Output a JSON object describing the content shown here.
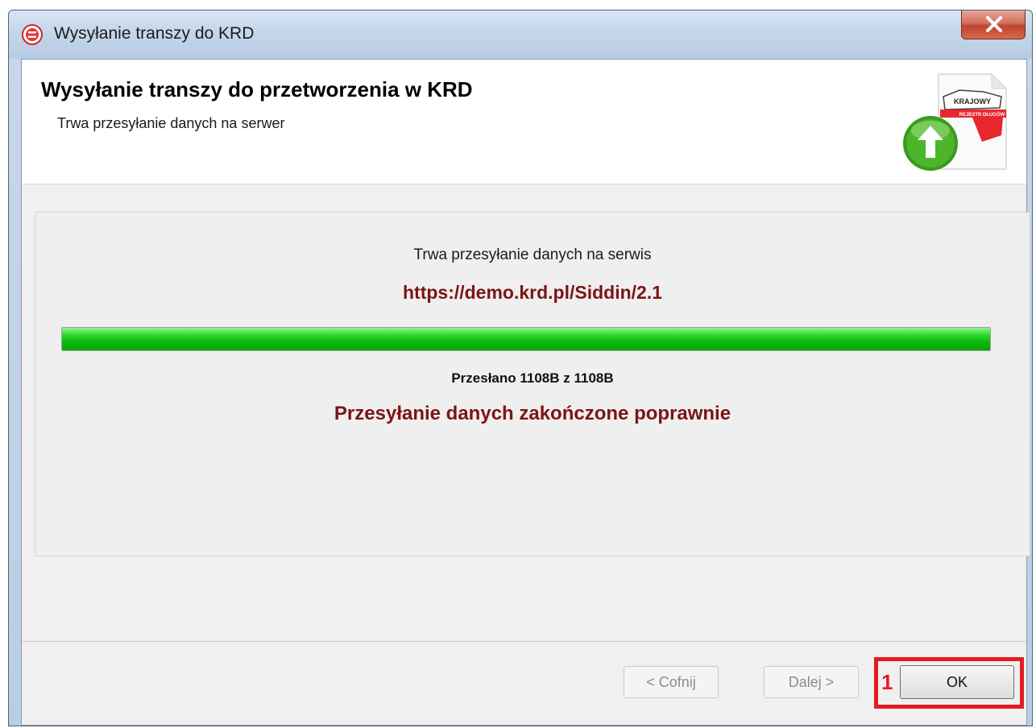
{
  "window": {
    "title": "Wysyłanie transzy do KRD"
  },
  "header": {
    "title": "Wysyłanie transzy do przetworzenia w KRD",
    "subtitle": "Trwa przesyłanie danych na serwer",
    "logo_text_top": "KRAJOWY",
    "logo_text_band": "REJESTR DŁUGÓW"
  },
  "main": {
    "status_text": "Trwa przesyłanie danych na serwis",
    "url": "https://demo.krd.pl/Siddin/2.1",
    "progress_percent": 100,
    "sent_text": "Przesłano 1108B z 1108B",
    "done_text": "Przesyłanie danych zakończone poprawnie"
  },
  "footer": {
    "back_label": "< Cofnij",
    "next_label": "Dalej >",
    "ok_label": "OK",
    "annotation_number": "1"
  },
  "colors": {
    "accent_text": "#7b1515",
    "progress": "#0dbb0d",
    "annotation": "#e31b23"
  },
  "icons": {
    "app": "krd-app-icon",
    "close": "close-icon",
    "logo": "krd-document-upload-icon"
  }
}
